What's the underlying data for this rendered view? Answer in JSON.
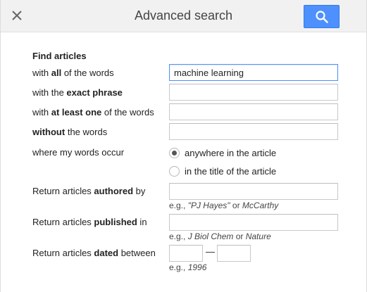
{
  "header": {
    "title": "Advanced search"
  },
  "find_articles": {
    "section_title": "Find articles",
    "all_words": {
      "label_pre": "with ",
      "label_bold": "all",
      "label_post": " of the words",
      "value": "machine learning"
    },
    "exact_phrase": {
      "label_pre": "with the ",
      "label_bold": "exact phrase",
      "label_post": "",
      "value": ""
    },
    "at_least_one": {
      "label_pre": "with ",
      "label_bold": "at least one",
      "label_post": " of the words",
      "value": ""
    },
    "without": {
      "label_pre": "",
      "label_bold": "without",
      "label_post": " the words",
      "value": ""
    },
    "occur": {
      "label": "where my words occur",
      "options": [
        {
          "label": "anywhere in the article",
          "checked": true
        },
        {
          "label": "in the title of the article",
          "checked": false
        }
      ]
    }
  },
  "authored": {
    "label_pre": "Return articles ",
    "label_bold": "authored",
    "label_post": " by",
    "value": "",
    "hint_pre": "e.g., ",
    "hint_ex1": "\"PJ Hayes\"",
    "hint_mid": " or ",
    "hint_ex2": "McCarthy"
  },
  "published": {
    "label_pre": "Return articles ",
    "label_bold": "published",
    "label_post": " in",
    "value": "",
    "hint_pre": "e.g., ",
    "hint_ex1": "J Biol Chem",
    "hint_mid": " or ",
    "hint_ex2": "Nature"
  },
  "dated": {
    "label_pre": "Return articles ",
    "label_bold": "dated",
    "label_post": " between",
    "from_value": "",
    "to_value": "",
    "separator": "—",
    "hint_pre": "e.g., ",
    "hint_ex1": "1996"
  },
  "icons": {
    "close": "close-icon",
    "search": "search-icon"
  },
  "colors": {
    "search_button": "#4d90fe",
    "focus_border": "#4d90fe"
  }
}
